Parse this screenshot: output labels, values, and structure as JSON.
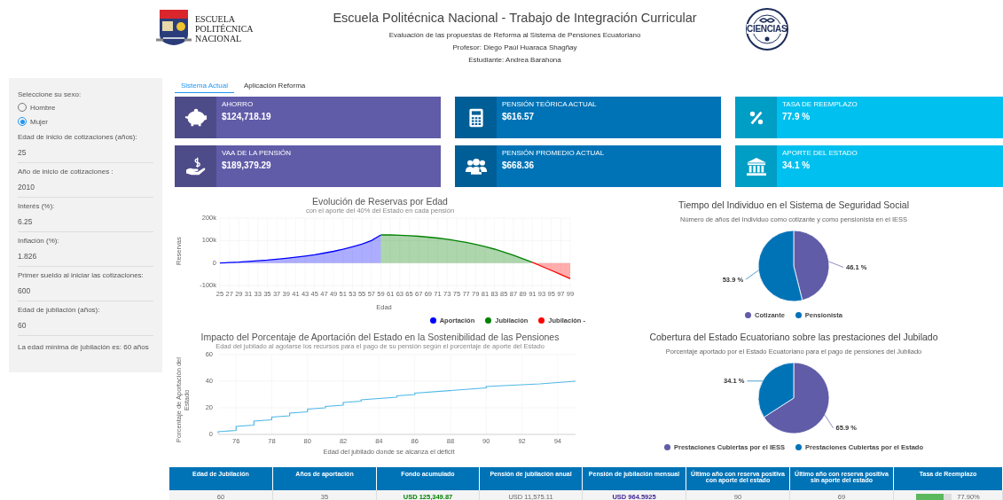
{
  "header": {
    "logo_left_text": [
      "ESCUELA",
      "POLITÉCNICA",
      "NACIONAL"
    ],
    "title": "Escuela Politécnica Nacional - Trabajo de Integración Curricular",
    "subtitle": "Evaluación de las propuestas de Reforma al Sistema de Pensiones Ecuatoriano",
    "professor": "Profesor: Diego Paúl Huaraca Shagñay",
    "student": "Estudiante: Andrea Barahona",
    "logo_right_text": "CIENCIAS"
  },
  "sidebar": {
    "sex_label": "Seleccione su sexo:",
    "sex_options": [
      {
        "label": "Hombre",
        "selected": false
      },
      {
        "label": "Mujer",
        "selected": true
      }
    ],
    "fields": [
      {
        "label": "Edad de inicio de cotizaciones (años):",
        "value": "25"
      },
      {
        "label": "Año de inicio de cotizaciones :",
        "value": "2010"
      },
      {
        "label": "Interés (%):",
        "value": "6.25"
      },
      {
        "label": "Inflación (%):",
        "value": "1.826"
      },
      {
        "label": "Primer sueldo al iniciar las cotizaciones:",
        "value": "600"
      },
      {
        "label": "Edad de jubilación (años):",
        "value": "60"
      }
    ],
    "note": "La edad mínima de jubilación es: 60 años"
  },
  "tabs": [
    {
      "label": "Sistema Actual",
      "selected": true
    },
    {
      "label": "Aplicación Reforma",
      "selected": false
    }
  ],
  "cards": [
    {
      "title": "AHORRO",
      "value": "$124,718.19",
      "kind": "piggy-bank",
      "color": "#605ca8"
    },
    {
      "title": "PENSIÓN TEÓRICA ACTUAL",
      "value": "$616.57",
      "kind": "calculator",
      "color": "#0073b7"
    },
    {
      "title": "TASA DE REEMPLAZO",
      "value": "77.9 %",
      "kind": "percent",
      "color": "#00c0ef"
    },
    {
      "title": "VAA DE LA PENSIÓN",
      "value": "$189,379.29",
      "kind": "hand-dollar",
      "color": "#605ca8"
    },
    {
      "title": "PENSIÓN PROMEDIO ACTUAL",
      "value": "$668.36",
      "kind": "people",
      "color": "#0073b7"
    },
    {
      "title": "APORTE DEL ESTADO",
      "value": "34.1 %",
      "kind": "bank",
      "color": "#00c0ef"
    }
  ],
  "reserves_chart": {
    "subtitle": "con el aporte del 40% del Estado en cada pensión",
    "chart_data": {
      "type": "area",
      "title": "Evolución de Reservas por Edad",
      "xlabel": "Edad",
      "ylabel": "Reservas",
      "grid": true,
      "x": [
        25,
        27,
        29,
        31,
        33,
        35,
        37,
        39,
        41,
        43,
        45,
        47,
        49,
        51,
        53,
        55,
        57,
        59,
        61,
        63,
        65,
        67,
        69,
        71,
        73,
        75,
        77,
        79,
        81,
        83,
        85,
        87,
        89,
        91,
        93,
        95,
        97,
        99
      ],
      "series": [
        {
          "name": "Aportación",
          "color": "#0000ff",
          "values": [
            0,
            2000,
            4000,
            7000,
            10000,
            13000,
            17000,
            21000,
            26000,
            31000,
            37000,
            44000,
            52000,
            61000,
            72000,
            84000,
            100000,
            125000,
            null,
            null,
            null,
            null,
            null,
            null,
            null,
            null,
            null,
            null,
            null,
            null,
            null,
            null,
            null,
            null,
            null,
            null,
            null,
            null
          ]
        },
        {
          "name": "Jubilación",
          "color": "#008000",
          "values": [
            null,
            null,
            null,
            null,
            null,
            null,
            null,
            null,
            null,
            null,
            null,
            null,
            null,
            null,
            null,
            null,
            null,
            125000,
            125000,
            124000,
            122000,
            119000,
            115000,
            111000,
            106000,
            99000,
            92000,
            83000,
            73000,
            62000,
            49000,
            35000,
            19000,
            3000,
            null,
            null,
            null,
            null
          ]
        },
        {
          "name": "Jubilación -",
          "color": "#ff0000",
          "values": [
            null,
            null,
            null,
            null,
            null,
            null,
            null,
            null,
            null,
            null,
            null,
            null,
            null,
            null,
            null,
            null,
            null,
            null,
            null,
            null,
            null,
            null,
            null,
            null,
            null,
            null,
            null,
            null,
            null,
            null,
            null,
            null,
            null,
            3000,
            -15000,
            -33000,
            -51000,
            -70000
          ]
        }
      ],
      "ylim": [
        -100000,
        200000
      ],
      "yticks": [
        {
          "value": -100000,
          "label": "-100k"
        },
        {
          "value": 0,
          "label": "0"
        },
        {
          "value": 100000,
          "label": "100k"
        },
        {
          "value": 200000,
          "label": "200k"
        }
      ]
    }
  },
  "impact_chart": {
    "subtitle": "Edad del jubilado al agotarse los recursos para el pago de su pensión según el porcentaje de aporte del Estado",
    "chart_data": {
      "type": "line",
      "title": "Impacto del Porcentaje de Aportación del Estado en la Sostenibilidad de las Pensiones",
      "xlabel": "Edad del jubilado donde se alcanza el déficit",
      "ylabel": "Porcentaje de Aportación del Estado",
      "grid": true,
      "x": [
        75,
        75,
        76,
        76,
        77,
        77,
        78,
        78,
        79,
        79,
        80,
        80,
        81,
        81,
        82,
        82,
        83,
        83,
        85,
        85,
        86,
        86,
        90,
        90,
        93,
        95
      ],
      "series": [
        {
          "color": "#4fb8e6",
          "values": [
            1,
            2,
            3,
            6,
            7,
            10,
            11,
            13,
            14,
            16,
            17,
            19,
            20,
            21,
            22,
            24,
            25,
            26,
            28,
            29,
            30,
            31,
            35,
            36,
            38,
            40
          ]
        }
      ],
      "xlim": [
        75,
        95
      ],
      "ylim": [
        0,
        60
      ],
      "xticks": [
        76,
        78,
        80,
        82,
        84,
        86,
        88,
        90,
        92,
        94
      ],
      "yticks": [
        0,
        20,
        40,
        60
      ]
    }
  },
  "time_chart": {
    "subtitle": "Número de años del Individuo como cotizante y como pensionista en el IESS",
    "chart_data": {
      "type": "pie",
      "title": "Tiempo del Individuo en el Sistema de Seguridad Social",
      "categories": [
        "Cotizante",
        "Pensionista"
      ],
      "values": [
        46.1,
        53.9
      ],
      "colors": [
        "#605ca8",
        "#0073b7"
      ],
      "value_labels": [
        "46.1 %",
        "53.9 %"
      ]
    }
  },
  "coverage_chart": {
    "subtitle": "Porcentaje aportado por el Estado Ecuatoriano para el pago de pensiones del Jubilado",
    "chart_data": {
      "type": "pie",
      "title": "Cobertura del Estado Ecuatoriano sobre las prestaciones del Jubilado",
      "categories": [
        "Prestaciones Cubiertas por el IESS",
        "Prestaciones Cubiertas por el Estado"
      ],
      "values": [
        65.9,
        34.1
      ],
      "colors": [
        "#605ca8",
        "#0073b7"
      ],
      "value_labels": [
        "65.9 %",
        "34.1 %"
      ]
    }
  },
  "table": {
    "columns": [
      "Edad de Jubilación",
      "Años de aportación",
      "Fondo acumulado",
      "Pensión de jubilación anual",
      "Pensión de jubilación mensual",
      "Último año con reserva positiva con aporte del estado",
      "Último año con reserva positiva sin aporte del estado",
      "Tasa de Reemplazo"
    ],
    "rows": [
      [
        {
          "kind": "plain",
          "text": "60"
        },
        {
          "kind": "plain",
          "text": "35"
        },
        {
          "kind": "fund",
          "text": "USD 125,349.87"
        },
        {
          "kind": "plain",
          "text": "USD 11,575.11"
        },
        {
          "kind": "pension",
          "text": "USD 964.5925"
        },
        {
          "kind": "plain",
          "text": "90"
        },
        {
          "kind": "plain",
          "text": "69"
        },
        {
          "kind": "bar",
          "text": "77.90%",
          "level": 0.779
        }
      ]
    ]
  }
}
